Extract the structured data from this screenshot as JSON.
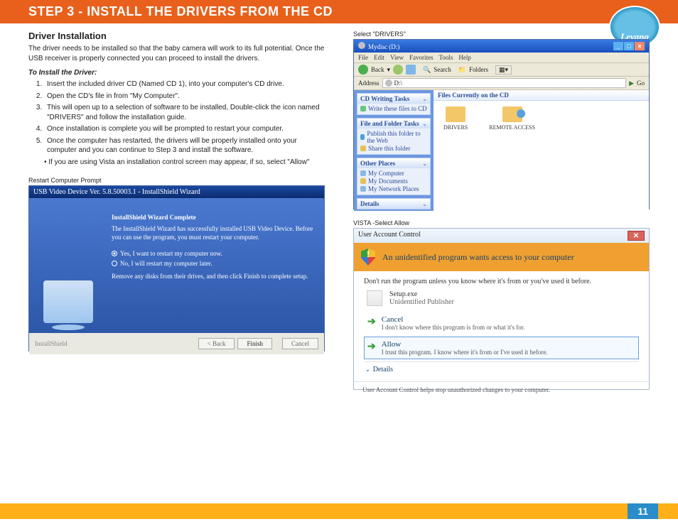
{
  "header": {
    "title": "STEP 3   -  INSTALL THE DRIVERS FROM THE CD"
  },
  "logo": {
    "name": "Levana"
  },
  "left": {
    "heading": "Driver Installation",
    "intro": "The driver needs to be installed so that the baby camera will work to its full potential. Once the USB receiver is properly connected you can proceed to install the drivers.",
    "subhead": "To Install the Driver:",
    "steps": [
      "Insert the included driver CD (Named CD 1), into your computer's CD drive.",
      "Open the CD's file in from \"My Computer\".",
      "This will open up to a selection of software to be installed, Double-click the icon named \"DRIVERS\" and follow the installation guide.",
      "Once installation is complete you will be prompted to restart your computer.",
      "Once the computer has restarted, the drivers will be properly installed onto your computer and you can continue to Step 3 and install the software."
    ],
    "substep": "If you are using Vista an installation control screen may appear, if so, select \"Allow\"",
    "caption1": "Restart Computer Prompt"
  },
  "installshield": {
    "title": "USB Video Device Ver. 5.8.50003.1 - InstallShield Wizard",
    "heading": "InstallShield Wizard Complete",
    "body": "The InstallShield Wizard has successfully installed USB Video Device. Before you can use the program, you must restart your computer.",
    "opt1": "Yes, I want to restart my computer now.",
    "opt2": "No, I will restart my computer later.",
    "body2": "Remove any disks from their drives, and then click Finish to complete setup.",
    "brand": "InstallShield",
    "back": "< Back",
    "finish": "Finish",
    "cancel": "Cancel"
  },
  "right": {
    "caption_ex": "Select \"DRIVERS\"",
    "caption_uac": "VISTA -Select Allow"
  },
  "explorer": {
    "title": "Mydisc (D:)",
    "menu": [
      "File",
      "Edit",
      "View",
      "Favorites",
      "Tools",
      "Help"
    ],
    "toolbar": {
      "back": "Back",
      "search": "Search",
      "folders": "Folders"
    },
    "address_label": "Address",
    "address_value": "D:\\",
    "go": "Go",
    "panels": {
      "p1h": "CD Writing Tasks",
      "p1i": [
        "Write these files to CD"
      ],
      "p2h": "File and Folder Tasks",
      "p2i": [
        "Publish this folder to the Web",
        "Share this folder"
      ],
      "p3h": "Other Places",
      "p3i": [
        "My Computer",
        "My Documents",
        "My Network Places"
      ],
      "p4h": "Details"
    },
    "main_h": "Files Currently on the CD",
    "file1": "DRIVERS",
    "file2": "REMOTE ACCESS"
  },
  "uac": {
    "title": "User Account Control",
    "banner": "An unidentified program wants access to your computer",
    "warn": "Don't run the program unless you know where it's from or you've used it before.",
    "prog_name": "Setup.exe",
    "prog_pub": "Unidentified Publisher",
    "cancel_h": "Cancel",
    "cancel_d": "I don't know where this program is from or what it's for.",
    "allow_h": "Allow",
    "allow_d": "I trust this program. I know where it's from or I've used it before.",
    "details": "Details",
    "footer": "User Account Control helps stop unauthorized changes to your computer."
  },
  "page_number": "11"
}
